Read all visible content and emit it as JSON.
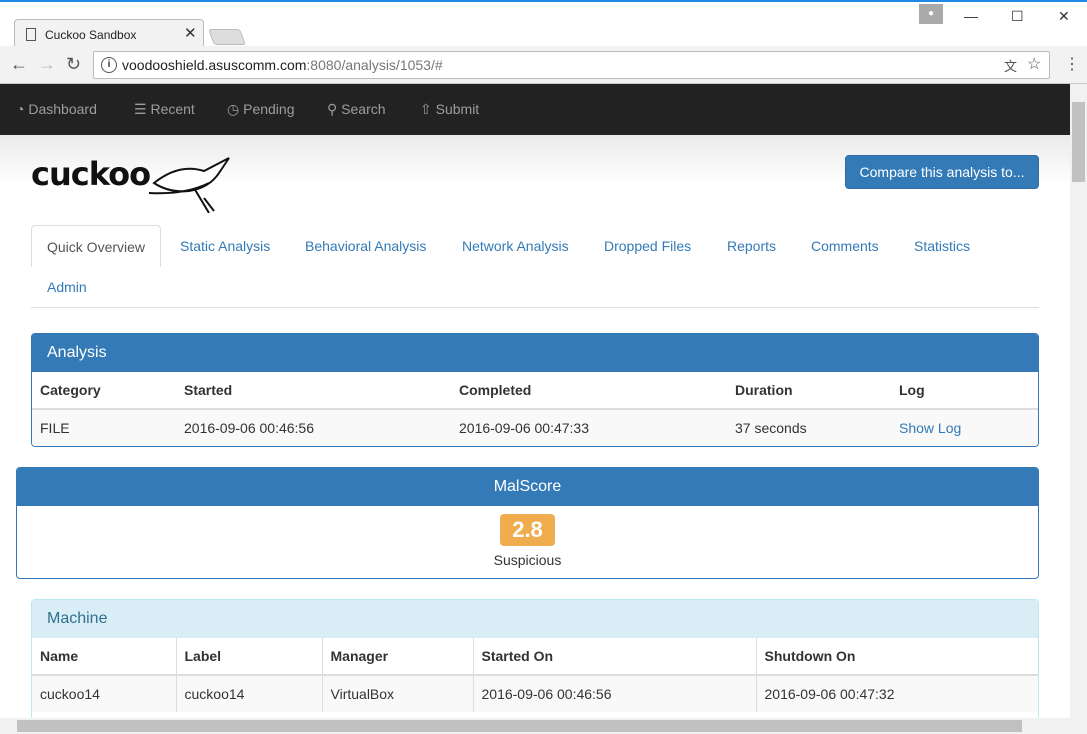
{
  "browser": {
    "tab_title": "Cuckoo Sandbox",
    "url_host": "voodooshield.asuscomm.com",
    "url_path": ":8080/analysis/1053/#"
  },
  "nav": [
    {
      "label": "Dashboard",
      "icon": "dashboard-icon"
    },
    {
      "label": "Recent",
      "icon": "list-icon"
    },
    {
      "label": "Pending",
      "icon": "clock-icon"
    },
    {
      "label": "Search",
      "icon": "search-icon"
    },
    {
      "label": "Submit",
      "icon": "upload-icon"
    }
  ],
  "logo": "cuckoo",
  "compare_button": "Compare this analysis to...",
  "tabs": [
    "Quick Overview",
    "Static Analysis",
    "Behavioral Analysis",
    "Network Analysis",
    "Dropped Files",
    "Reports",
    "Comments",
    "Statistics",
    "Admin"
  ],
  "analysis": {
    "title": "Analysis",
    "headers": [
      "Category",
      "Started",
      "Completed",
      "Duration",
      "Log"
    ],
    "row": [
      "FILE",
      "2016-09-06 00:46:56",
      "2016-09-06 00:47:33",
      "37 seconds",
      "Show Log"
    ]
  },
  "malscore": {
    "title": "MalScore",
    "score": "2.8",
    "verdict": "Suspicious",
    "color": "#f0ad4e"
  },
  "machine": {
    "title": "Machine",
    "headers": [
      "Name",
      "Label",
      "Manager",
      "Started On",
      "Shutdown On"
    ],
    "row": [
      "cuckoo14",
      "cuckoo14",
      "VirtualBox",
      "2016-09-06 00:46:56",
      "2016-09-06 00:47:32"
    ]
  }
}
